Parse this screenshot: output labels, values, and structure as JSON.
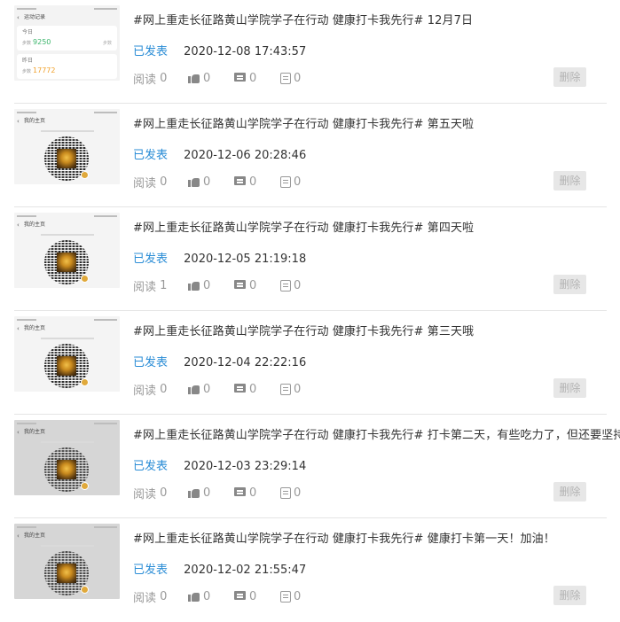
{
  "posts": [
    {
      "title": "#网上重走长征路黄山学院学子在行动 健康打卡我先行# 12月7日",
      "status": "已发表",
      "time": "2020-12-08 17:43:57",
      "read_label": "阅读",
      "read": "0",
      "like": "0",
      "comment": "0",
      "forward": "0",
      "delete_label": "删除",
      "thumb": "steps",
      "steps_app": {
        "header": "运动记录",
        "today_label": "今日",
        "today_prefix": "步数",
        "today_steps": "9250",
        "today_rank": "步数",
        "yesterday_label": "昨日",
        "yesterday_prefix": "步数",
        "yesterday_steps": "17772"
      }
    },
    {
      "title": "#网上重走长征路黄山学院学子在行动 健康打卡我先行# 第五天啦",
      "status": "已发表",
      "time": "2020-12-06 20:28:46",
      "read_label": "阅读",
      "read": "0",
      "like": "0",
      "comment": "0",
      "forward": "0",
      "delete_label": "删除",
      "thumb": "qr",
      "thumb_header": "我的主页"
    },
    {
      "title": "#网上重走长征路黄山学院学子在行动 健康打卡我先行# 第四天啦",
      "status": "已发表",
      "time": "2020-12-05 21:19:18",
      "read_label": "阅读",
      "read": "1",
      "like": "0",
      "comment": "0",
      "forward": "0",
      "delete_label": "删除",
      "thumb": "qr",
      "thumb_header": "我的主页"
    },
    {
      "title": "#网上重走长征路黄山学院学子在行动 健康打卡我先行# 第三天哦",
      "status": "已发表",
      "time": "2020-12-04 22:22:16",
      "read_label": "阅读",
      "read": "0",
      "like": "0",
      "comment": "0",
      "forward": "0",
      "delete_label": "删除",
      "thumb": "qr",
      "thumb_header": "我的主页"
    },
    {
      "title": "#网上重走长征路黄山学院学子在行动 健康打卡我先行# 打卡第二天，有些吃力了，但还要坚持",
      "status": "已发表",
      "time": "2020-12-03 23:29:14",
      "read_label": "阅读",
      "read": "0",
      "like": "0",
      "comment": "0",
      "forward": "0",
      "delete_label": "删除",
      "thumb": "qr-gray",
      "thumb_header": "我的主页"
    },
    {
      "title": "#网上重走长征路黄山学院学子在行动 健康打卡我先行# 健康打卡第一天！加油！",
      "status": "已发表",
      "time": "2020-12-02 21:55:47",
      "read_label": "阅读",
      "read": "0",
      "like": "0",
      "comment": "0",
      "forward": "0",
      "delete_label": "删除",
      "thumb": "qr-gray",
      "thumb_header": "我的主页"
    }
  ],
  "colors": {
    "status_blue": "#2b8dd6",
    "meta_gray": "#999999",
    "delete_bg": "#e7e7e7",
    "steps_green": "#3bb56b",
    "steps_orange": "#f0a22e"
  }
}
